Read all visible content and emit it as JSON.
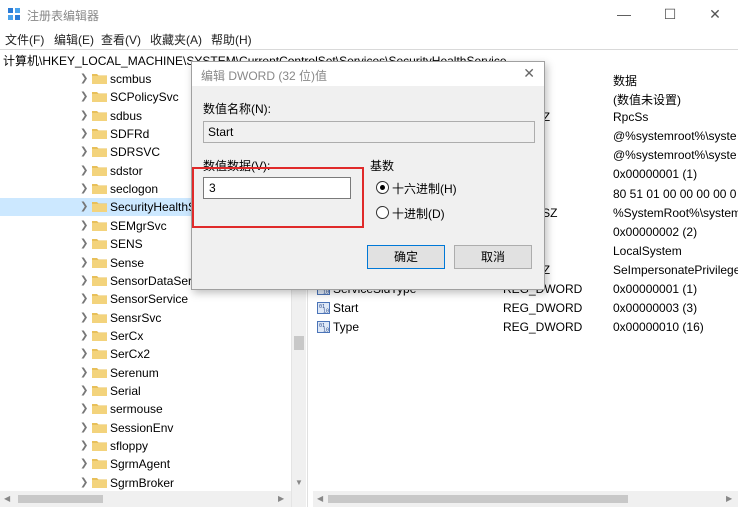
{
  "window": {
    "title": "注册表编辑器",
    "minimize": "—",
    "maximize": "☐",
    "close": "✕"
  },
  "menu": [
    "文件(F)",
    "编辑(E)",
    "查看(V)",
    "收藏夹(A)",
    "帮助(H)"
  ],
  "address": "计算机\\HKEY_LOCAL_MACHINE\\SYSTEM\\CurrentControlSet\\Services\\SecurityHealthService",
  "tree": {
    "items": [
      "scmbus",
      "SCPolicySvc",
      "sdbus",
      "SDFRd",
      "SDRSVC",
      "sdstor",
      "seclogon",
      "SecurityHealthS",
      "SEMgrSvc",
      "SENS",
      "Sense",
      "SensorDataServ",
      "SensorService",
      "SensrSvc",
      "SerCx",
      "SerCx2",
      "Serenum",
      "Serial",
      "sermouse",
      "SessionEnv",
      "sfloppy",
      "SgrmAgent",
      "SgrmBroker"
    ],
    "selected_index": 7
  },
  "values": {
    "header_data": "数据",
    "rows": [
      {
        "name": "",
        "type": "",
        "data": "(数值未设置)"
      },
      {
        "name": "",
        "type": "ULTI_SZ",
        "data": "RpcSs"
      },
      {
        "name": "",
        "type": "",
        "data": "@%systemroot%\\syste"
      },
      {
        "name": "",
        "type": "",
        "data": "@%systemroot%\\syste"
      },
      {
        "name": "",
        "type": "WORD",
        "data": "0x00000001 (1)"
      },
      {
        "name": "",
        "type": "NARY",
        "data": "80 51 01 00 00 00 00 0"
      },
      {
        "name": "",
        "type": "PAND_SZ",
        "data": "%SystemRoot%\\system"
      },
      {
        "name": "",
        "type": "WORD",
        "data": "0x00000002 (2)"
      },
      {
        "name": "",
        "type": "",
        "data": "LocalSystem"
      },
      {
        "name": "",
        "type": "ULTI_SZ",
        "data": "SeImpersonatePrivilege"
      },
      {
        "name": "ServiceSidType",
        "type": "REG_DWORD",
        "data": "0x00000001 (1)"
      },
      {
        "name": "Start",
        "type": "REG_DWORD",
        "data": "0x00000003 (3)"
      },
      {
        "name": "Type",
        "type": "REG_DWORD",
        "data": "0x00000010 (16)"
      }
    ]
  },
  "dialog": {
    "title": "编辑 DWORD (32 位)值",
    "close": "✕",
    "name_label": "数值名称(N):",
    "name_value": "Start",
    "data_label": "数值数据(V):",
    "data_value": "3",
    "base_label": "基数",
    "hex_label": "十六进制(H)",
    "dec_label": "十进制(D)",
    "hex_selected": true,
    "ok_label": "确定",
    "cancel_label": "取消"
  },
  "colors": {
    "selection": "#cce8ff",
    "highlight_box": "#e02a2a",
    "folder": "#e8c05a"
  }
}
